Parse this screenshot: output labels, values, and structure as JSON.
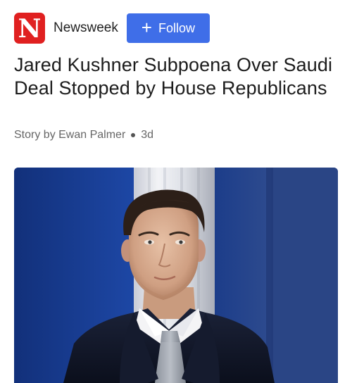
{
  "source": {
    "logo_letter": "N",
    "name": "Newsweek",
    "follow_label": "Follow"
  },
  "article": {
    "headline": "Jared Kushner Subpoena Over Saudi Deal Stopped by House Republicans",
    "byline": "Story by Ewan Palmer",
    "age": "3d",
    "image_subject": "photo-of-man-in-suit"
  },
  "colors": {
    "brand_red": "#e02020",
    "follow_blue": "#3f6ee8"
  }
}
